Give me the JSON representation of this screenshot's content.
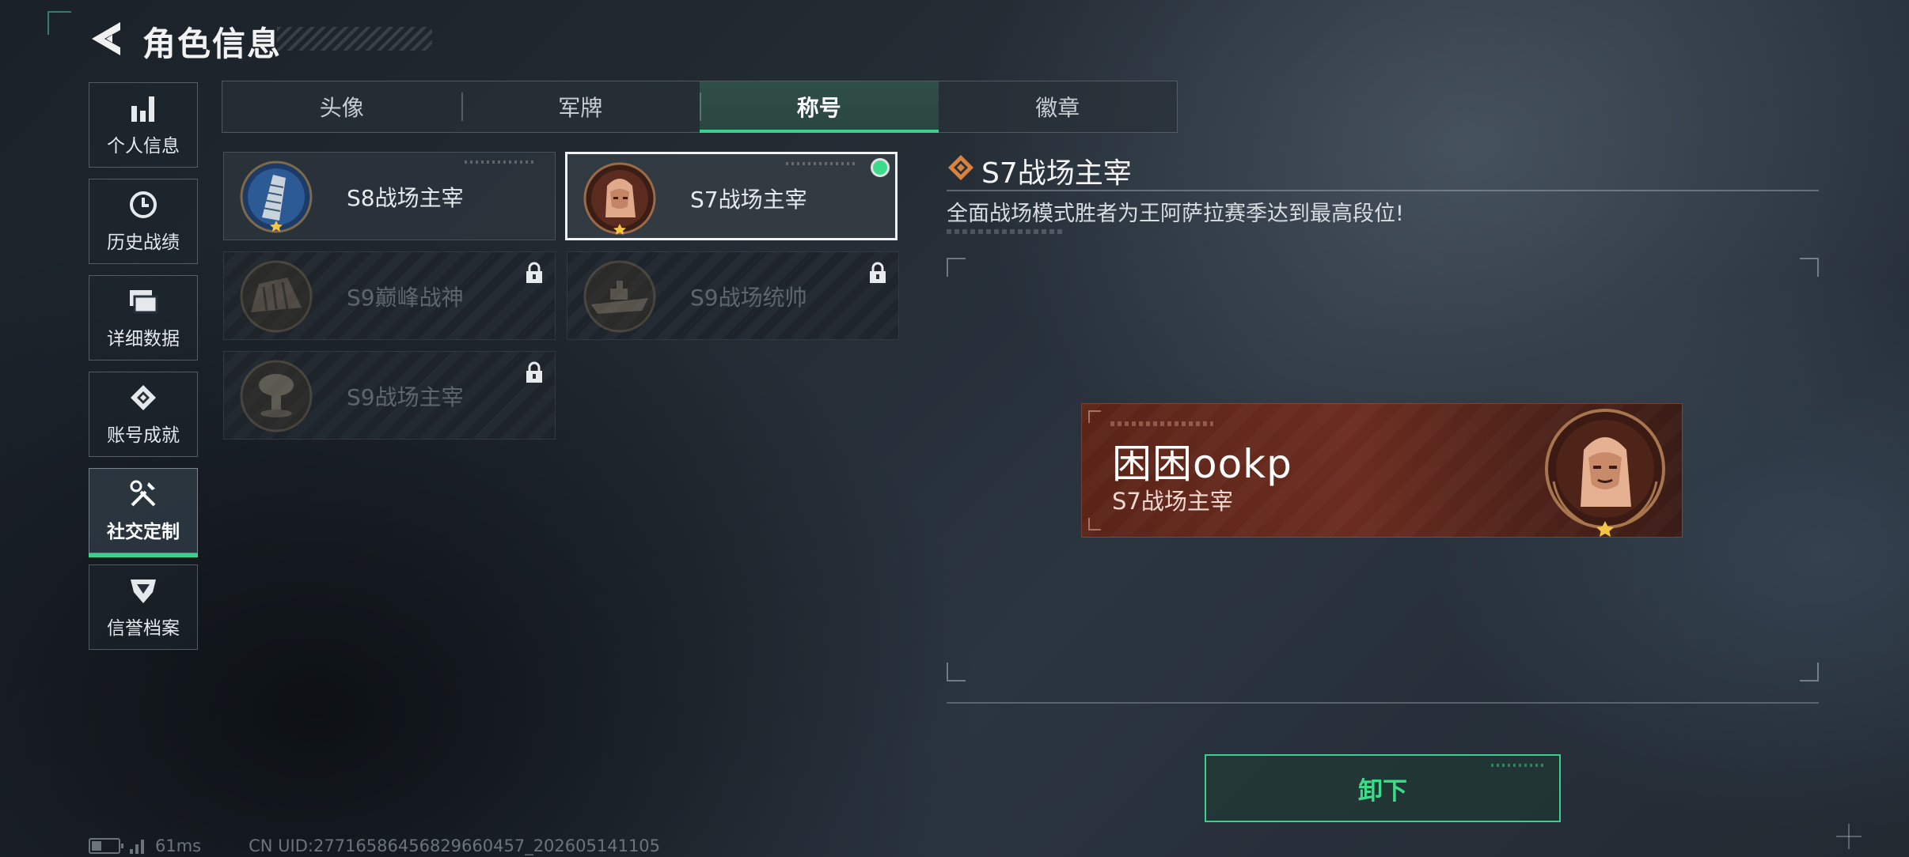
{
  "header": {
    "title": "角色信息"
  },
  "sidebar": {
    "items": [
      {
        "label": "个人信息",
        "icon": "bar-chart-icon"
      },
      {
        "label": "历史战绩",
        "icon": "history-clock-icon"
      },
      {
        "label": "详细数据",
        "icon": "folder-icon"
      },
      {
        "label": "账号成就",
        "icon": "achievement-icon"
      },
      {
        "label": "社交定制",
        "icon": "tools-icon",
        "active": true
      },
      {
        "label": "信誉档案",
        "icon": "credibility-shield-icon"
      }
    ]
  },
  "tabs": [
    {
      "label": "头像"
    },
    {
      "label": "军牌"
    },
    {
      "label": "称号",
      "active": true
    },
    {
      "label": "徽章"
    }
  ],
  "titles": [
    {
      "name": "S8战场主宰",
      "locked": false,
      "selected": false
    },
    {
      "name": "S7战场主宰",
      "locked": false,
      "selected": true,
      "equipped": true
    },
    {
      "name": "S9巅峰战神",
      "locked": true
    },
    {
      "name": "S9战场统帅",
      "locked": true
    },
    {
      "name": "S9战场主宰",
      "locked": true
    }
  ],
  "detail": {
    "title": "S7战场主宰",
    "description": "全面战场模式胜者为王阿萨拉赛季达到最高段位!"
  },
  "nameplate": {
    "player_name": "困困ookp",
    "title": "S7战场主宰"
  },
  "actions": {
    "unequip_label": "卸下"
  },
  "status": {
    "ping": "61ms",
    "uid": "CN UID:27716586456829660457_202605141105"
  },
  "colors": {
    "accent": "#3ccf8e",
    "equipped_dot": "#3ddc8a",
    "nameplate_bg": "#6b2c1f"
  }
}
